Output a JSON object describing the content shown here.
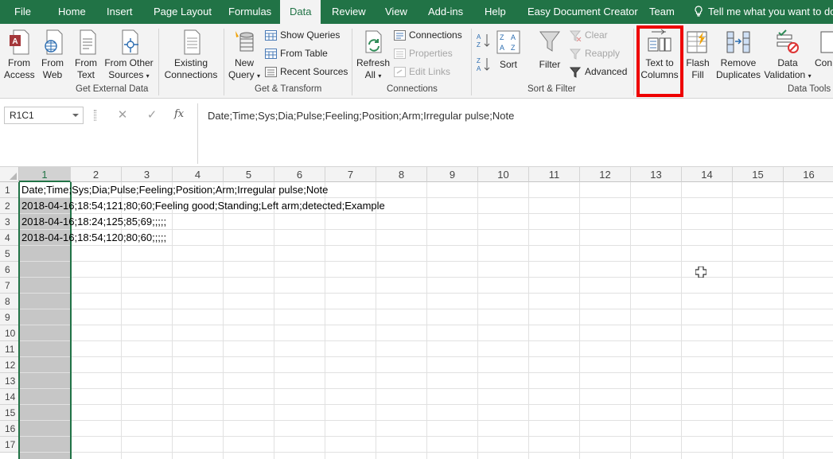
{
  "tabs": {
    "file": "File",
    "home": "Home",
    "insert": "Insert",
    "page_layout": "Page Layout",
    "formulas": "Formulas",
    "data": "Data",
    "review": "Review",
    "view": "View",
    "addins": "Add-ins",
    "help": "Help",
    "easy_doc": "Easy Document Creator",
    "team": "Team",
    "tell_me": "Tell me what you want to do"
  },
  "ribbon": {
    "get_external": {
      "group_label": "Get External Data",
      "from_access": [
        "From",
        "Access"
      ],
      "from_web": [
        "From",
        "Web"
      ],
      "from_text": [
        "From",
        "Text"
      ],
      "from_other": [
        "From Other",
        "Sources"
      ],
      "existing": [
        "Existing",
        "Connections"
      ]
    },
    "get_transform": {
      "group_label": "Get & Transform",
      "new_query": [
        "New",
        "Query"
      ],
      "show_queries": "Show Queries",
      "from_table": "From Table",
      "recent_sources": "Recent Sources"
    },
    "connections": {
      "group_label": "Connections",
      "refresh_all": [
        "Refresh",
        "All"
      ],
      "connections": "Connections",
      "properties": "Properties",
      "edit_links": "Edit Links"
    },
    "sort_filter": {
      "group_label": "Sort & Filter",
      "sort": "Sort",
      "filter": "Filter",
      "clear": "Clear",
      "reapply": "Reapply",
      "advanced": "Advanced"
    },
    "data_tools": {
      "group_label": "Data Tools",
      "text_to_columns": [
        "Text to",
        "Columns"
      ],
      "flash_fill": [
        "Flash",
        "Fill"
      ],
      "remove_duplicates": [
        "Remove",
        "Duplicates"
      ],
      "data_validation": [
        "Data",
        "Validation"
      ],
      "consolidate_partial": "Con"
    }
  },
  "formula_bar": {
    "name_box": "R1C1",
    "fx": "fx",
    "formula": "Date;Time;Sys;Dia;Pulse;Feeling;Position;Arm;Irregular pulse;Note"
  },
  "grid": {
    "columns": [
      "1",
      "2",
      "3",
      "4",
      "5",
      "6",
      "7",
      "8",
      "9",
      "10",
      "11",
      "12",
      "13",
      "14",
      "15",
      "16"
    ],
    "rows": [
      "1",
      "2",
      "3",
      "4",
      "5",
      "6",
      "7",
      "8",
      "9",
      "10",
      "11",
      "12",
      "13",
      "14",
      "15",
      "16",
      "17"
    ],
    "cells": [
      "Date;Time;Sys;Dia;Pulse;Feeling;Position;Arm;Irregular pulse;Note",
      "2018-04-16;18:54;121;80;60;Feeling good;Standing;Left arm;detected;Example",
      "2018-04-16;18:24;125;85;69;;;;;",
      "2018-04-16;18:54;120;80;60;;;;;"
    ]
  },
  "colors": {
    "excel_green": "#217346",
    "highlight": "#e00000"
  }
}
